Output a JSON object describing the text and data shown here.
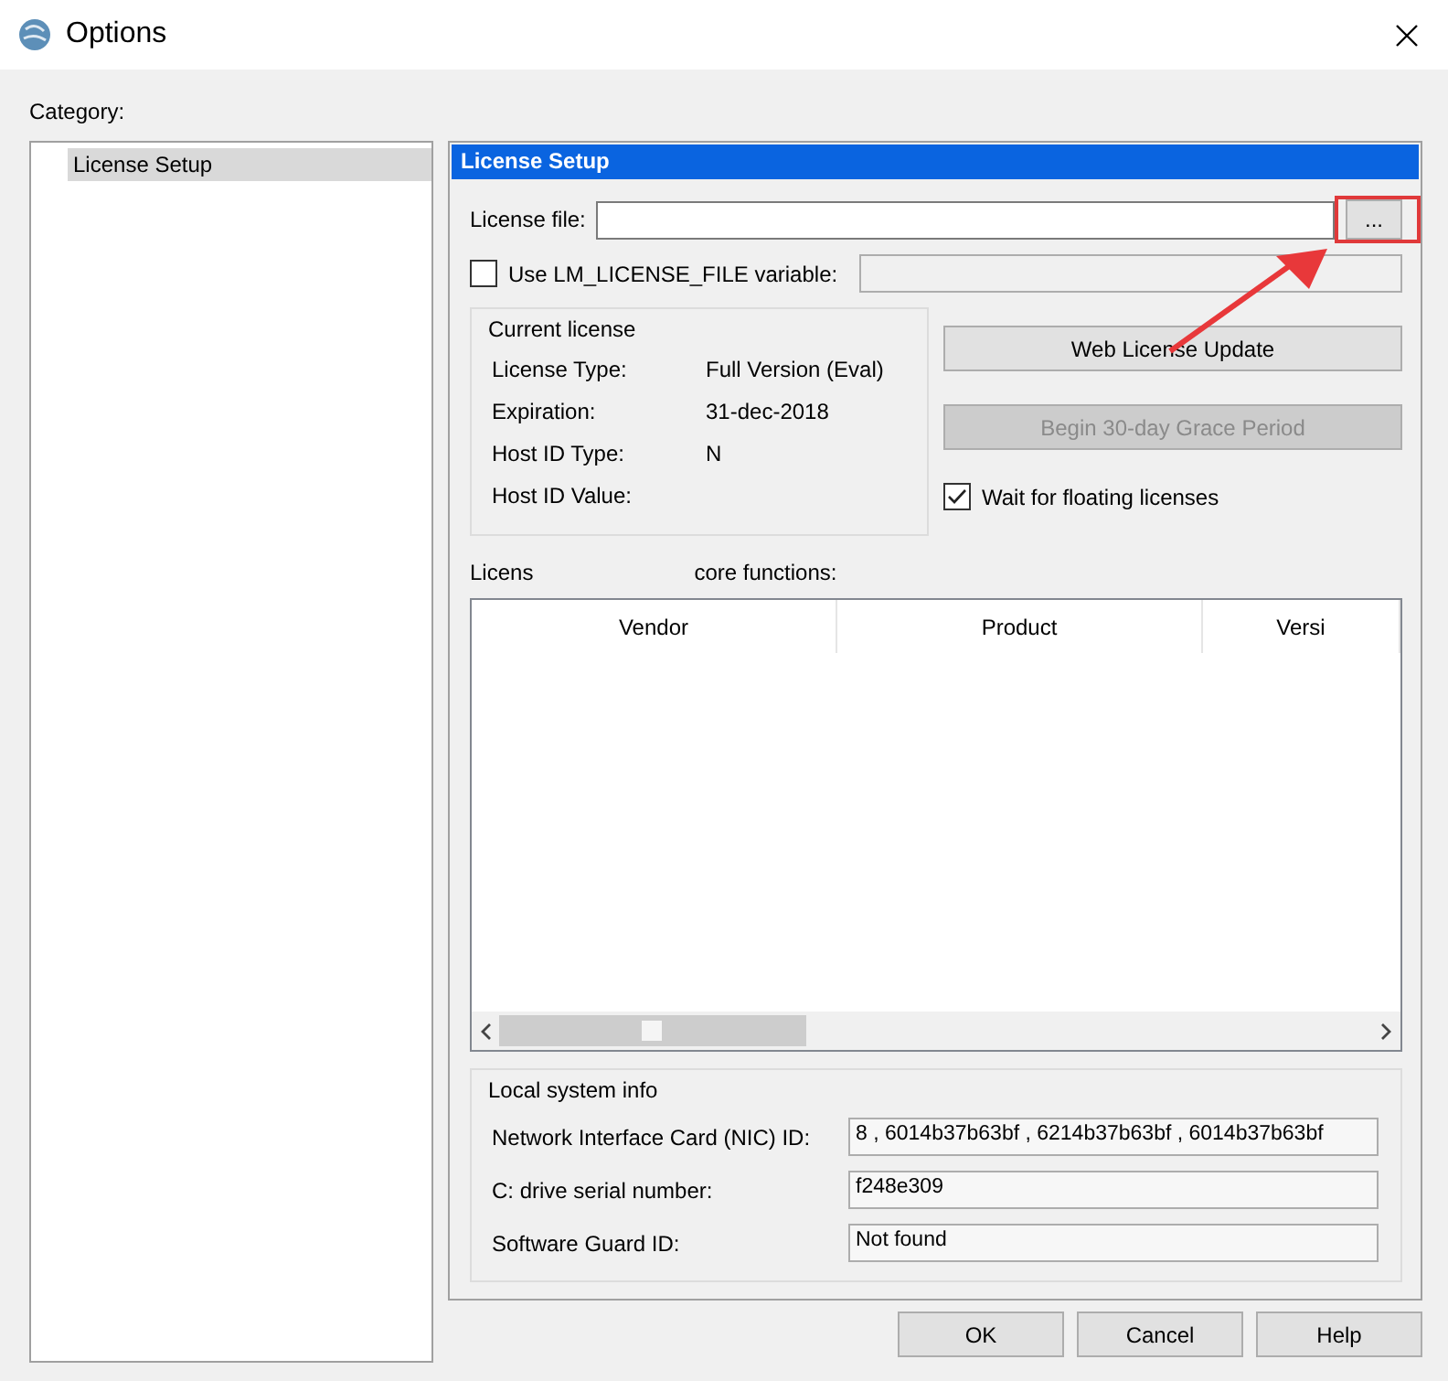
{
  "window": {
    "title": "Options"
  },
  "category": {
    "label": "Category:",
    "items": [
      {
        "label": "License Setup",
        "selected": true
      }
    ]
  },
  "panel": {
    "title": "License Setup",
    "license_file": {
      "label": "License file:",
      "browse": "..."
    },
    "use_env": {
      "label": "Use LM_LICENSE_FILE variable:",
      "checked": false
    },
    "current_license": {
      "title": "Current license",
      "rows": [
        {
          "label": "License Type:",
          "value": "Full Version (Eval)"
        },
        {
          "label": "Expiration:",
          "value": "31-dec-2018"
        },
        {
          "label": "Host ID Type:",
          "value": "N"
        },
        {
          "label": "Host ID Value:"
        }
      ]
    },
    "actions": [
      {
        "label": "Web License Update",
        "disabled": false
      },
      {
        "label": "Begin 30-day Grace Period",
        "disabled": true
      }
    ],
    "wait_floating": {
      "label": "Wait for floating licenses",
      "checked": true
    },
    "features_label": [
      "Licens",
      "core functions:"
    ],
    "table": {
      "columns": [
        "Vendor",
        "Product",
        "Versi"
      ]
    },
    "local_info": {
      "title": "Local system info",
      "rows": [
        {
          "label": "Network Interface Card (NIC) ID:",
          "value": "8 , 6014b37b63bf , 6214b37b63bf , 6014b37b63bf"
        },
        {
          "label": "C: drive serial number:",
          "value": "f248e309"
        },
        {
          "label": "Software Guard ID:",
          "value": "Not found"
        }
      ]
    }
  },
  "footer_buttons": [
    "OK",
    "Cancel",
    "Help"
  ]
}
